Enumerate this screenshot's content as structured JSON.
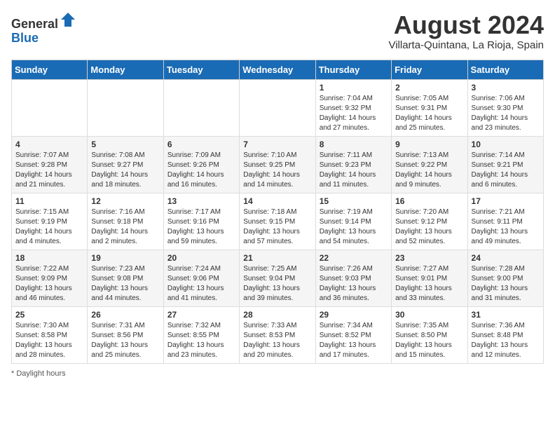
{
  "header": {
    "logo_line1": "General",
    "logo_line2": "Blue",
    "month_title": "August 2024",
    "location": "Villarta-Quintana, La Rioja, Spain"
  },
  "weekdays": [
    "Sunday",
    "Monday",
    "Tuesday",
    "Wednesday",
    "Thursday",
    "Friday",
    "Saturday"
  ],
  "weeks": [
    [
      {
        "day": "",
        "info": ""
      },
      {
        "day": "",
        "info": ""
      },
      {
        "day": "",
        "info": ""
      },
      {
        "day": "",
        "info": ""
      },
      {
        "day": "1",
        "info": "Sunrise: 7:04 AM\nSunset: 9:32 PM\nDaylight: 14 hours and 27 minutes."
      },
      {
        "day": "2",
        "info": "Sunrise: 7:05 AM\nSunset: 9:31 PM\nDaylight: 14 hours and 25 minutes."
      },
      {
        "day": "3",
        "info": "Sunrise: 7:06 AM\nSunset: 9:30 PM\nDaylight: 14 hours and 23 minutes."
      }
    ],
    [
      {
        "day": "4",
        "info": "Sunrise: 7:07 AM\nSunset: 9:28 PM\nDaylight: 14 hours and 21 minutes."
      },
      {
        "day": "5",
        "info": "Sunrise: 7:08 AM\nSunset: 9:27 PM\nDaylight: 14 hours and 18 minutes."
      },
      {
        "day": "6",
        "info": "Sunrise: 7:09 AM\nSunset: 9:26 PM\nDaylight: 14 hours and 16 minutes."
      },
      {
        "day": "7",
        "info": "Sunrise: 7:10 AM\nSunset: 9:25 PM\nDaylight: 14 hours and 14 minutes."
      },
      {
        "day": "8",
        "info": "Sunrise: 7:11 AM\nSunset: 9:23 PM\nDaylight: 14 hours and 11 minutes."
      },
      {
        "day": "9",
        "info": "Sunrise: 7:13 AM\nSunset: 9:22 PM\nDaylight: 14 hours and 9 minutes."
      },
      {
        "day": "10",
        "info": "Sunrise: 7:14 AM\nSunset: 9:21 PM\nDaylight: 14 hours and 6 minutes."
      }
    ],
    [
      {
        "day": "11",
        "info": "Sunrise: 7:15 AM\nSunset: 9:19 PM\nDaylight: 14 hours and 4 minutes."
      },
      {
        "day": "12",
        "info": "Sunrise: 7:16 AM\nSunset: 9:18 PM\nDaylight: 14 hours and 2 minutes."
      },
      {
        "day": "13",
        "info": "Sunrise: 7:17 AM\nSunset: 9:16 PM\nDaylight: 13 hours and 59 minutes."
      },
      {
        "day": "14",
        "info": "Sunrise: 7:18 AM\nSunset: 9:15 PM\nDaylight: 13 hours and 57 minutes."
      },
      {
        "day": "15",
        "info": "Sunrise: 7:19 AM\nSunset: 9:14 PM\nDaylight: 13 hours and 54 minutes."
      },
      {
        "day": "16",
        "info": "Sunrise: 7:20 AM\nSunset: 9:12 PM\nDaylight: 13 hours and 52 minutes."
      },
      {
        "day": "17",
        "info": "Sunrise: 7:21 AM\nSunset: 9:11 PM\nDaylight: 13 hours and 49 minutes."
      }
    ],
    [
      {
        "day": "18",
        "info": "Sunrise: 7:22 AM\nSunset: 9:09 PM\nDaylight: 13 hours and 46 minutes."
      },
      {
        "day": "19",
        "info": "Sunrise: 7:23 AM\nSunset: 9:08 PM\nDaylight: 13 hours and 44 minutes."
      },
      {
        "day": "20",
        "info": "Sunrise: 7:24 AM\nSunset: 9:06 PM\nDaylight: 13 hours and 41 minutes."
      },
      {
        "day": "21",
        "info": "Sunrise: 7:25 AM\nSunset: 9:04 PM\nDaylight: 13 hours and 39 minutes."
      },
      {
        "day": "22",
        "info": "Sunrise: 7:26 AM\nSunset: 9:03 PM\nDaylight: 13 hours and 36 minutes."
      },
      {
        "day": "23",
        "info": "Sunrise: 7:27 AM\nSunset: 9:01 PM\nDaylight: 13 hours and 33 minutes."
      },
      {
        "day": "24",
        "info": "Sunrise: 7:28 AM\nSunset: 9:00 PM\nDaylight: 13 hours and 31 minutes."
      }
    ],
    [
      {
        "day": "25",
        "info": "Sunrise: 7:30 AM\nSunset: 8:58 PM\nDaylight: 13 hours and 28 minutes."
      },
      {
        "day": "26",
        "info": "Sunrise: 7:31 AM\nSunset: 8:56 PM\nDaylight: 13 hours and 25 minutes."
      },
      {
        "day": "27",
        "info": "Sunrise: 7:32 AM\nSunset: 8:55 PM\nDaylight: 13 hours and 23 minutes."
      },
      {
        "day": "28",
        "info": "Sunrise: 7:33 AM\nSunset: 8:53 PM\nDaylight: 13 hours and 20 minutes."
      },
      {
        "day": "29",
        "info": "Sunrise: 7:34 AM\nSunset: 8:52 PM\nDaylight: 13 hours and 17 minutes."
      },
      {
        "day": "30",
        "info": "Sunrise: 7:35 AM\nSunset: 8:50 PM\nDaylight: 13 hours and 15 minutes."
      },
      {
        "day": "31",
        "info": "Sunrise: 7:36 AM\nSunset: 8:48 PM\nDaylight: 13 hours and 12 minutes."
      }
    ]
  ],
  "footer": {
    "note": "Daylight hours"
  }
}
